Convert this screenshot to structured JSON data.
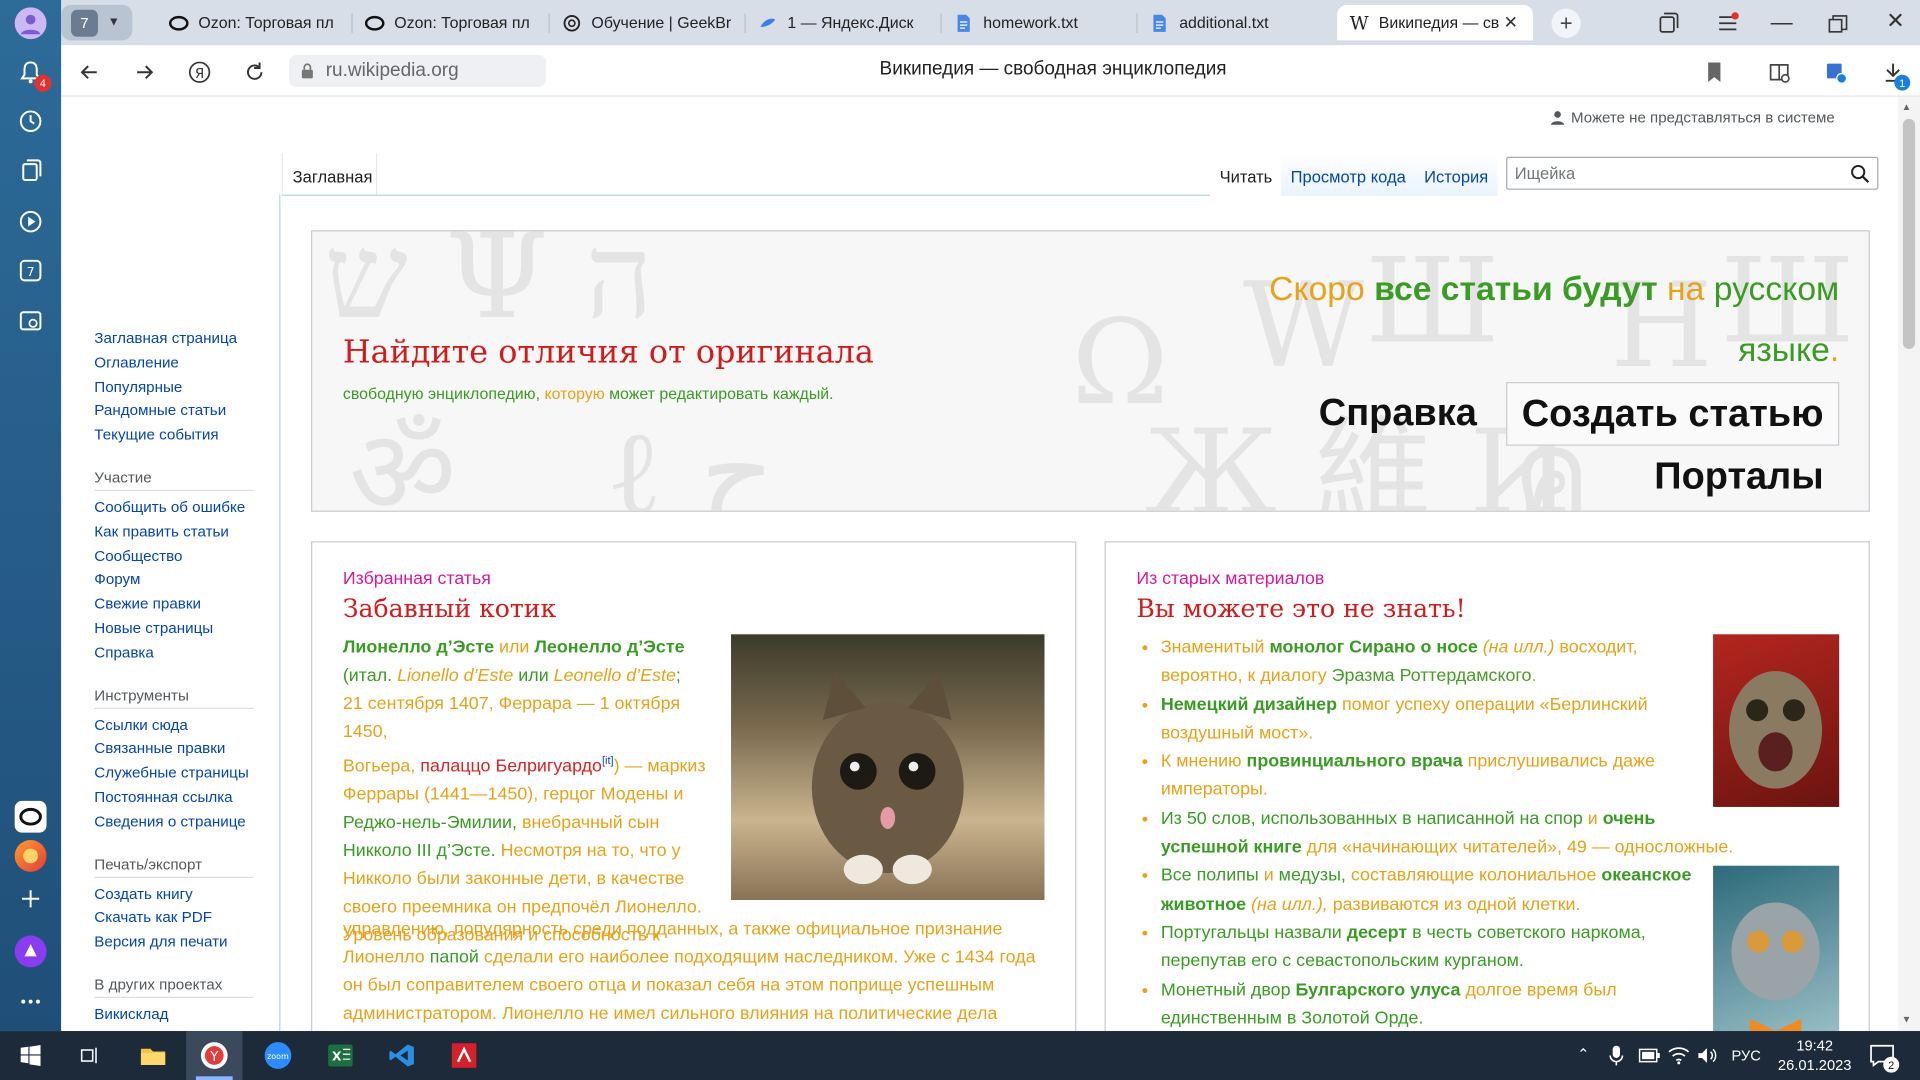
{
  "browser": {
    "tab_count": "7",
    "tabs": [
      {
        "label": "Ozon: Торговая пл"
      },
      {
        "label": "Ozon: Торговая пл"
      },
      {
        "label": "Обучение | GeekBr"
      },
      {
        "label": "1 — Яндекс.Диск"
      },
      {
        "label": "homework.txt"
      },
      {
        "label": "additional.txt"
      },
      {
        "label": "Википедия — св"
      }
    ],
    "url": "ru.wikipedia.org",
    "page_title": "Википедия — свободная энциклопедия",
    "notif_badge": "4",
    "download_badge": "1"
  },
  "wiki": {
    "personal": "Можете не представляться в системе",
    "tabs": {
      "main": "Заглавная",
      "read": "Читать",
      "source": "Просмотр кода",
      "history": "История"
    },
    "search_placeholder": "Ищейка",
    "sidebar": {
      "nav": [
        "Заглавная страница",
        "Оглавление",
        "Популярные",
        "Рандомные статьи",
        "Текущие события"
      ],
      "participation_title": "Участие",
      "participation": [
        "Сообщить об ошибке",
        "Как править статьи",
        "Сообщество",
        "Форум",
        "Свежие правки",
        "Новые страницы",
        "Справка"
      ],
      "tools_title": "Инструменты",
      "tools": [
        "Ссылки сюда",
        "Связанные правки",
        "Служебные страницы",
        "Постоянная ссылка",
        "Сведения о странице"
      ],
      "print_title": "Печать/экспорт",
      "print": [
        "Создать книгу",
        "Скачать как PDF",
        "Версия для печати"
      ],
      "projects_title": "В других проектах",
      "projects": [
        "Викисклад"
      ]
    },
    "banner": {
      "heading": "Найдите отличия от оригинала",
      "sub1": "свободную энциклопедию,",
      "sub2": "которую",
      "sub3": "может редактировать каждый.",
      "soon1": "Скоро",
      "soon2": "все статьи будут",
      "soon3": "на",
      "soon4": "русском",
      "soon5": "языке",
      "soon6": ".",
      "help": "Справка",
      "create": "Создать статью",
      "portals": "Порталы"
    },
    "featured": {
      "label": "Избранная статья",
      "title": "Забавный котик",
      "t1": "Лионелло д’Эсте",
      "t2": "или",
      "t3": "Леонелло д’Эсте",
      "t4": "(итал.",
      "t5": "Lionello d’Este",
      "t6": "или",
      "t7": "Leonello d’Este",
      "t8": ";",
      "t9": "21 сентября 1407, Феррара — 1 октября 1450,",
      "t10": "Вогьера,",
      "t11": "палаццо Белригуардо",
      "t12": "[it]",
      "t13": ") — маркиз",
      "t14": "Феррары",
      "t15": "(1441—1450), герцог",
      "t16": "Модены и",
      "t17": "Реджо-нель-Эмилии,",
      "t18": "внебрачный сын",
      "t19": "Никколо III д’Эсте.",
      "t20": "Несмотря на то, что у",
      "t21": "Никколо были законные дети, в качестве",
      "t22": "своего преемника он предпочёл Лионелло.",
      "t23": "Уровень образования и способность к",
      "t24": "управлению, популярность среди подданных, а также официальное признание",
      "t25": "Лионелло",
      "t26": "папой",
      "t27": "сделали его наиболее подходящим наследником. Уже с 1434 года",
      "t28": "он был соправителем своего отца и показал себя на этом поприще успешным",
      "t29": "администратором. Лионелло не имел сильного влияния на политические дела"
    },
    "dyk": {
      "label": "Из старых материалов",
      "title": "Вы можете это не знать!",
      "i1a": "Знаменитый",
      "i1b": "монолог Сирано о носе",
      "i1c": "(на илл.)",
      "i1d": "восходит,",
      "i1e": "вероятно, к диалогу",
      "i1f": "Эразма Роттердамского",
      "i1g": ".",
      "i2a": "Немецкий дизайнер",
      "i2b": "помог успеху операции «Берлинский",
      "i2c": "воздушный мост».",
      "i3a": "К мнению",
      "i3b": "провинциального врача",
      "i3c": "прислушивались даже",
      "i3d": "императоры.",
      "i4a": "Из 50 слов, использованных в написанной на спор",
      "i4b": "и",
      "i4c": "очень",
      "i4d": "успешной книге",
      "i4e": "для «начинающих читателей», 49 — односложные.",
      "i5a": "Все полипы",
      "i5b": "и",
      "i5c": "медузы,",
      "i5d": "составляющие колониальное",
      "i5e": "океанское",
      "i5f": "животное",
      "i5g": "(на илл.),",
      "i5h": "развиваются из одной клетки.",
      "i6a": "Португальцы назвали",
      "i6b": "десерт",
      "i6c": "в честь советского наркома,",
      "i6d": "перепутав его с севастопольским курганом.",
      "i7a": "Монетный двор",
      "i7b": "Булгарского улуса",
      "i7c": "долгое время был",
      "i7d": "единственным в Золотой Орде."
    }
  },
  "taskbar": {
    "lang": "РУС",
    "time": "19:42",
    "date": "26.01.2023",
    "notif": "2"
  },
  "colors": {
    "link": "#0645ad",
    "orange": "#e8a21a",
    "green": "#3a9c24",
    "magenta": "#d6189b",
    "red": "#dd1111"
  }
}
